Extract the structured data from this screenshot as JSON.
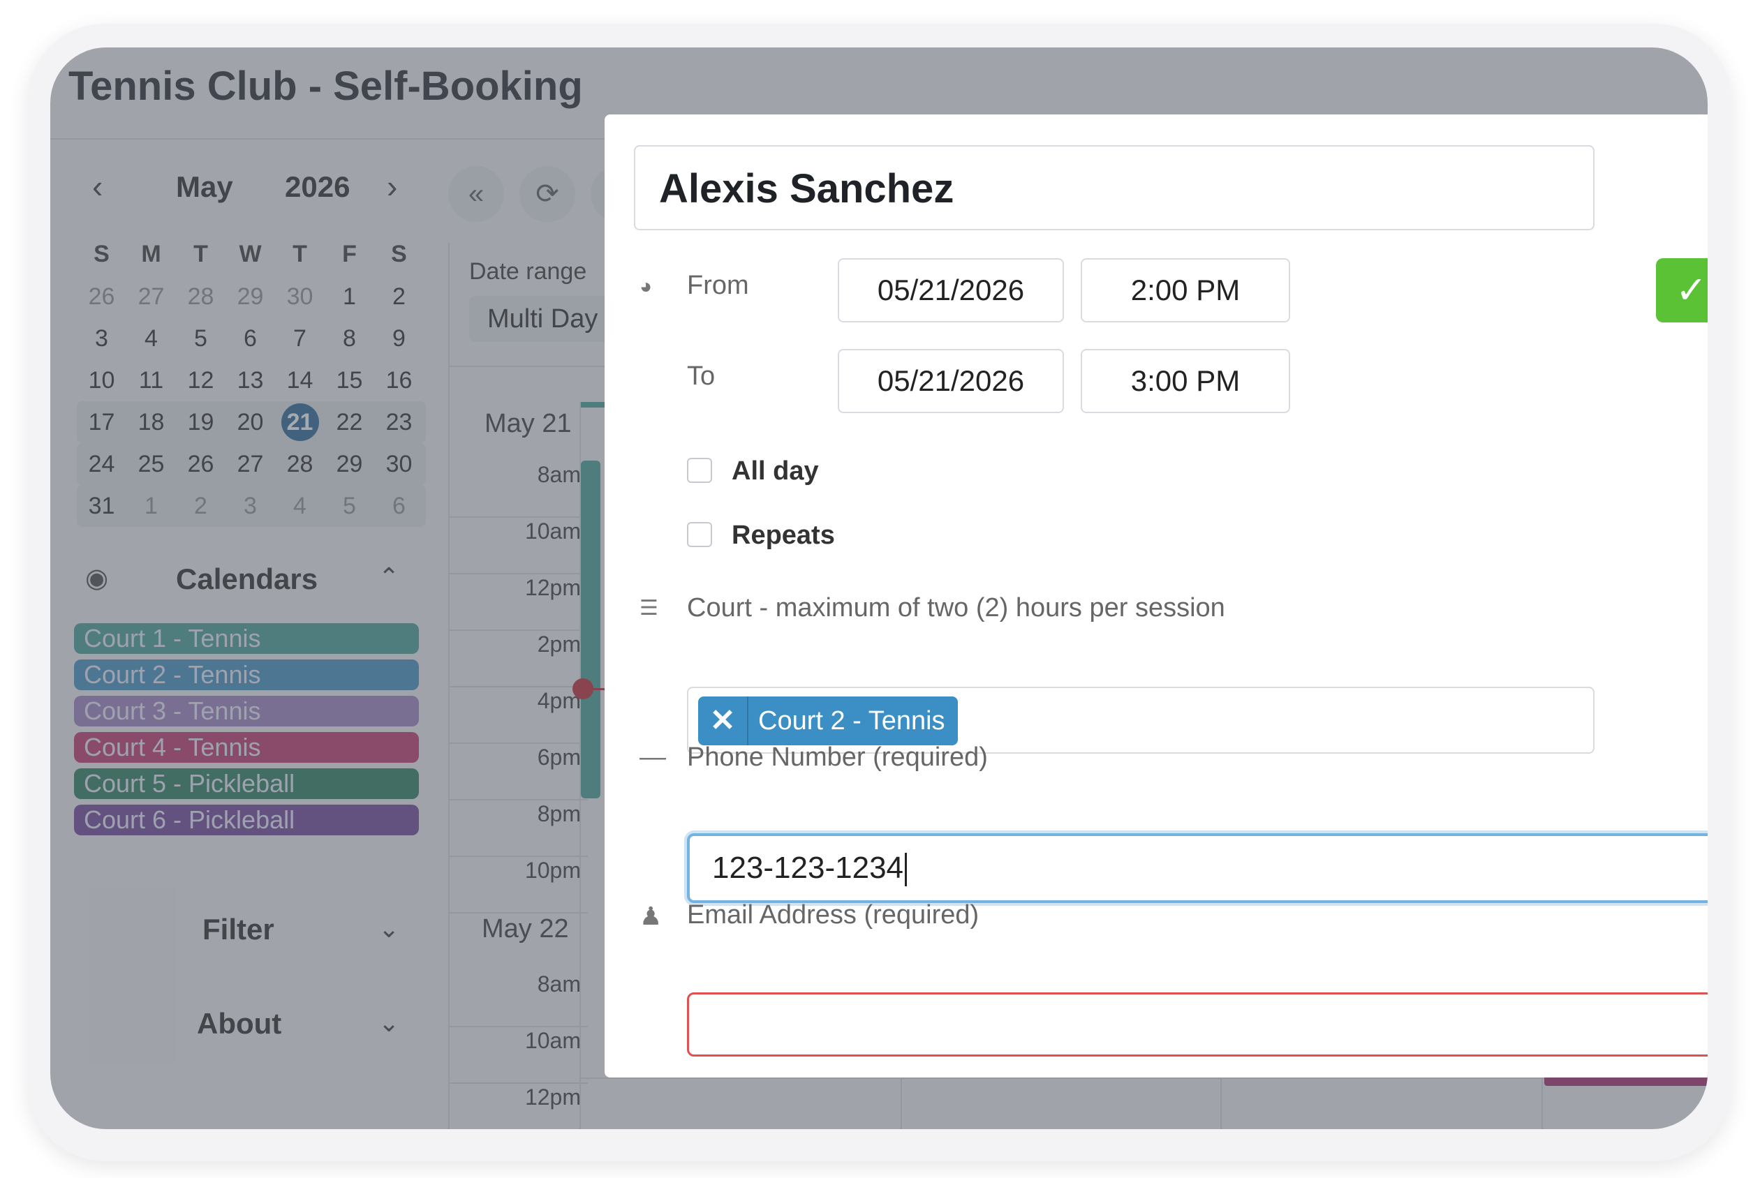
{
  "app": {
    "title": "Tennis Club - Self-Booking"
  },
  "mini_calendar": {
    "month": "May",
    "year": "2026",
    "weekday_headers": [
      "S",
      "M",
      "T",
      "W",
      "T",
      "F",
      "S"
    ],
    "weeks": [
      [
        "26",
        "27",
        "28",
        "29",
        "30",
        "1",
        "2"
      ],
      [
        "3",
        "4",
        "5",
        "6",
        "7",
        "8",
        "9"
      ],
      [
        "10",
        "11",
        "12",
        "13",
        "14",
        "15",
        "16"
      ],
      [
        "17",
        "18",
        "19",
        "20",
        "21",
        "22",
        "23"
      ],
      [
        "24",
        "25",
        "26",
        "27",
        "28",
        "29",
        "30"
      ],
      [
        "31",
        "1",
        "2",
        "3",
        "4",
        "5",
        "6"
      ]
    ],
    "today": "21"
  },
  "calendars": {
    "heading": "Calendars",
    "items": [
      {
        "label": "Court 1 - Tennis",
        "color": "#3f9b90"
      },
      {
        "label": "Court 2 - Tennis",
        "color": "#3b8fc4"
      },
      {
        "label": "Court 3 - Tennis",
        "color": "#9b7fc4"
      },
      {
        "label": "Court 4 - Tennis",
        "color": "#c0306a"
      },
      {
        "label": "Court 5 - Pickleball",
        "color": "#1f7a5a"
      },
      {
        "label": "Court 6 - Pickleball",
        "color": "#6a3e9a"
      }
    ]
  },
  "sections": {
    "filter": "Filter",
    "about": "About"
  },
  "toolbar": {
    "date_range_label": "Date range",
    "date_range_value": "Multi Day"
  },
  "schedule": {
    "days": [
      {
        "label": "May 21",
        "times": [
          "8am",
          "10am",
          "12pm",
          "2pm",
          "4pm",
          "6pm",
          "8pm",
          "10pm"
        ]
      },
      {
        "label": "May 22",
        "times": [
          "8am",
          "10am",
          "12pm"
        ]
      }
    ]
  },
  "event_form": {
    "title": "Alexis Sanchez",
    "from_label": "From",
    "to_label": "To",
    "from_date": "05/21/2026",
    "from_time": "2:00 PM",
    "to_date": "05/21/2026",
    "to_time": "3:00 PM",
    "all_day_label": "All day",
    "repeats_label": "Repeats",
    "court_label": "Court - maximum of two (2) hours per session",
    "court_tag": "Court 2 - Tennis",
    "phone_label": "Phone Number (required)",
    "phone_value": "123-123-1234",
    "email_label": "Email Address (required)",
    "email_value": ""
  }
}
